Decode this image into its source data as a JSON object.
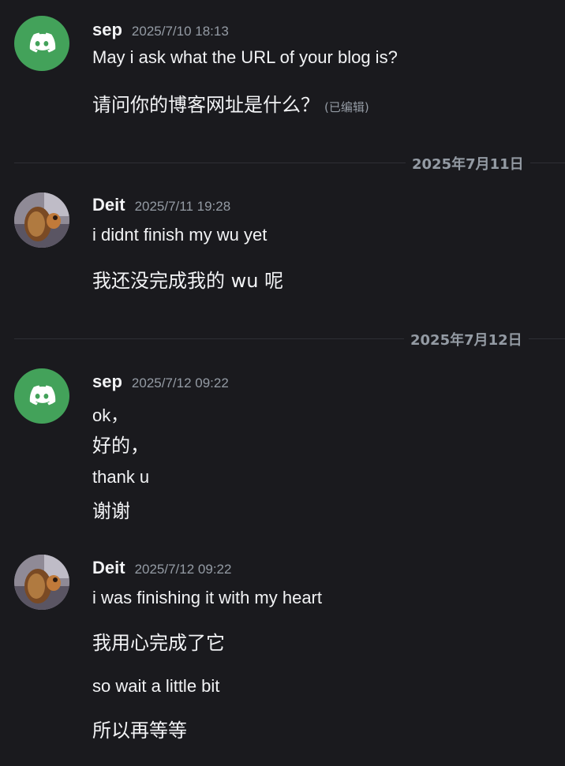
{
  "messages": [
    {
      "author": "sep",
      "timestamp": "2025/7/10 18:13",
      "avatar": "discord-logo-icon",
      "lines": [
        "May i ask what the URL of your blog is?",
        "请问你的博客网址是什么？"
      ],
      "edited_label": "(已编辑)"
    },
    {
      "author": "Deit",
      "timestamp": "2025/7/11 19:28",
      "avatar": "user-photo-avatar",
      "lines": [
        "i didnt finish my wu yet",
        "我还没完成我的 wu 呢"
      ]
    },
    {
      "author": "sep",
      "timestamp": "2025/7/12 09:22",
      "avatar": "discord-logo-icon",
      "lines": [
        "ok，",
        "好的，",
        "thank u",
        "谢谢"
      ]
    },
    {
      "author": "Deit",
      "timestamp": "2025/7/12 09:22",
      "avatar": "user-photo-avatar",
      "lines": [
        "i  was  finishing  it  with  my  heart",
        "我用心完成了它",
        "so  wait  a little  bit",
        "所以再等等"
      ]
    }
  ],
  "dividers": [
    "2025年7月11日",
    "2025年7月12日"
  ],
  "colors": {
    "background": "#1a1a1e",
    "discord_green": "#43a25a",
    "timestamp": "#949ba4"
  }
}
